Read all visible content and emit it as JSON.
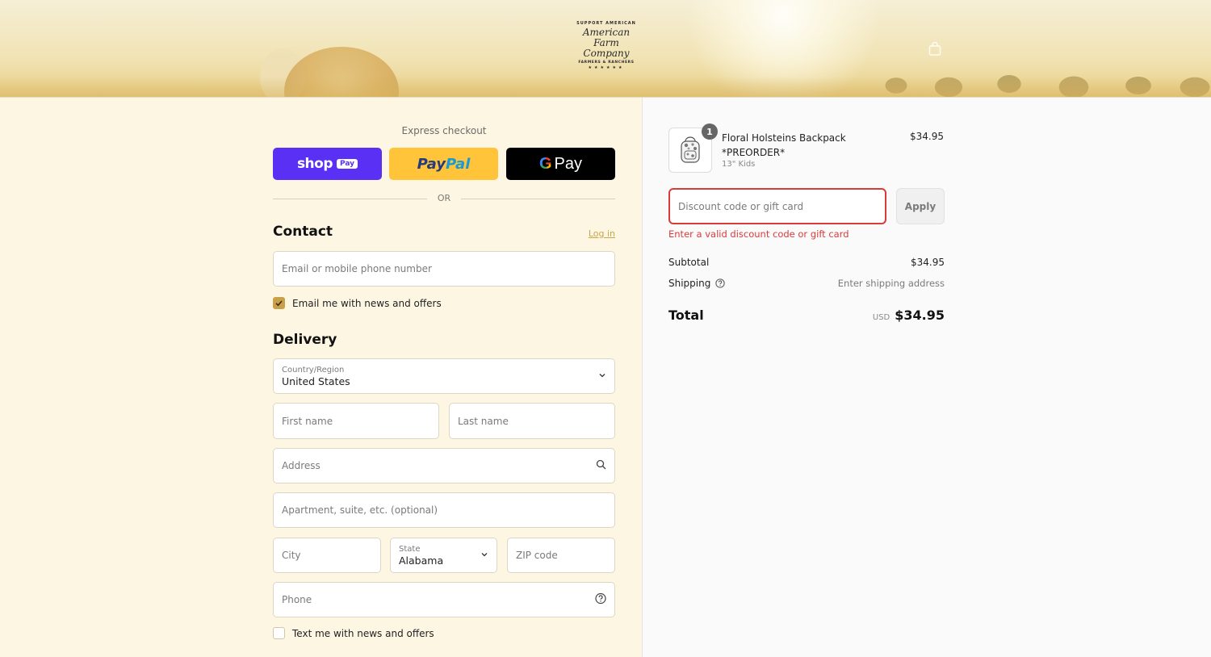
{
  "header": {
    "logo": {
      "arc_text": "SUPPORT AMERICAN",
      "line1": "American",
      "line2": "Farm Company",
      "line3": "FARMERS & RANCHERS",
      "stars": "★★★★★★"
    },
    "cart_icon": "shopping-bag-icon"
  },
  "checkout": {
    "express_title": "Express checkout",
    "shop_pay": {
      "word": "shop",
      "badge": "Pay"
    },
    "paypal": {
      "part1": "Pay",
      "part2": "Pal"
    },
    "gpay": {
      "g": "G",
      "pay": "Pay"
    },
    "or_text": "OR",
    "contact": {
      "heading": "Contact",
      "login_link": "Log in",
      "email_placeholder": "Email or mobile phone number",
      "email_offers_label": "Email me with news and offers",
      "email_offers_checked": true
    },
    "delivery": {
      "heading": "Delivery",
      "country_label": "Country/Region",
      "country_value": "United States",
      "first_name_placeholder": "First name",
      "last_name_placeholder": "Last name",
      "address_placeholder": "Address",
      "apartment_placeholder": "Apartment, suite, etc. (optional)",
      "city_placeholder": "City",
      "state_label": "State",
      "state_value": "Alabama",
      "zip_placeholder": "ZIP code",
      "phone_placeholder": "Phone",
      "text_offers_label": "Text me with news and offers",
      "text_offers_checked": false
    }
  },
  "summary": {
    "item": {
      "quantity": "1",
      "name": "Floral Holsteins Backpack *PREORDER*",
      "variant": "13\" Kids",
      "price": "$34.95"
    },
    "discount_placeholder": "Discount code or gift card",
    "apply_label": "Apply",
    "discount_error": "Enter a valid discount code or gift card",
    "subtotal_label": "Subtotal",
    "subtotal_value": "$34.95",
    "shipping_label": "Shipping",
    "shipping_value": "Enter shipping address",
    "total_label": "Total",
    "total_currency": "USD",
    "total_value": "$34.95"
  },
  "colors": {
    "accent": "#c9a04a",
    "error": "#d93b3b",
    "shop_pay": "#5a31f4",
    "paypal": "#ffc439",
    "page_bg": "#fdf6e2"
  }
}
